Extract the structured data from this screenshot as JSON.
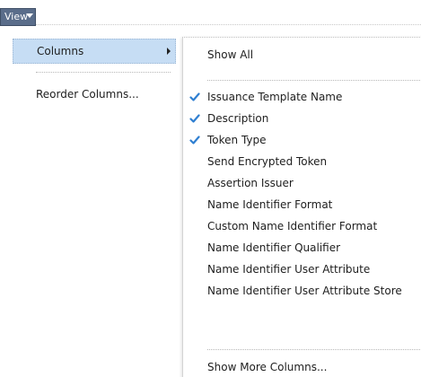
{
  "view_menu": {
    "label": "View",
    "items": [
      {
        "label": "Columns",
        "has_submenu": true,
        "highlighted": true
      },
      {
        "label": "Reorder Columns..."
      }
    ]
  },
  "columns_submenu": {
    "show_all": "Show All",
    "columns": [
      {
        "label": "Issuance Template Name",
        "checked": true
      },
      {
        "label": "Description",
        "checked": true
      },
      {
        "label": "Token Type",
        "checked": true
      },
      {
        "label": "Send Encrypted Token",
        "checked": false
      },
      {
        "label": "Assertion Issuer",
        "checked": false
      },
      {
        "label": "Name Identifier Format",
        "checked": false
      },
      {
        "label": "Custom Name Identifier Format",
        "checked": false
      },
      {
        "label": "Name Identifier Qualifier",
        "checked": false
      },
      {
        "label": "Name Identifier User Attribute",
        "checked": false
      },
      {
        "label": "Name Identifier User Attribute Store",
        "checked": false
      }
    ],
    "show_more": "Show More Columns..."
  },
  "colors": {
    "menu_button_bg": "#5a6d8a",
    "highlight_bg": "#c6ddf4",
    "check_color": "#2f7fd1",
    "text": "#1e1e1e"
  },
  "icons": {
    "menu_chevron": "chevron-down-icon",
    "submenu_arrow": "chevron-right-icon",
    "check": "checkmark-icon"
  }
}
